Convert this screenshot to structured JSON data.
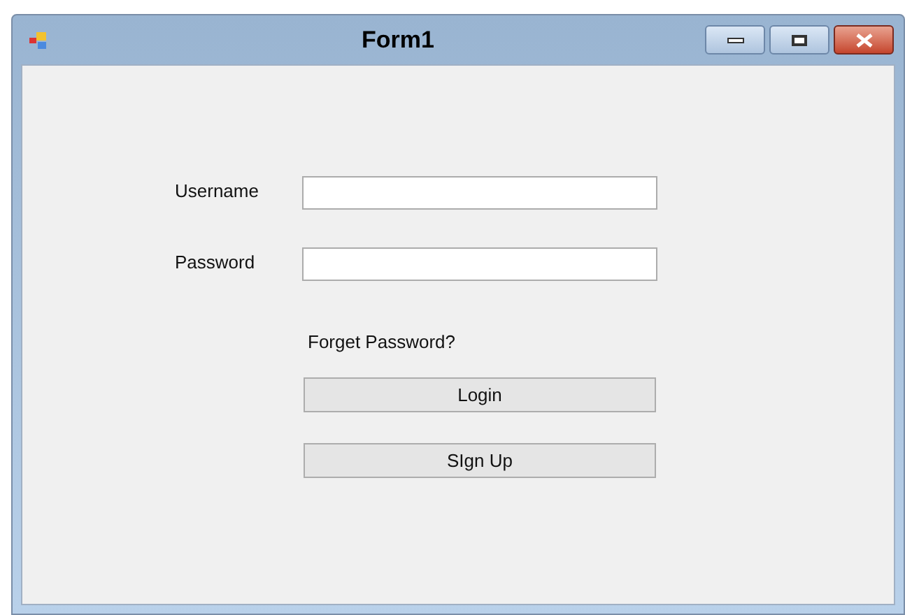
{
  "window": {
    "title": "Form1"
  },
  "fields": [
    {
      "label": "Username"
    },
    {
      "label": "Password"
    }
  ],
  "link": "Forget Password?",
  "buttons": [
    "Login",
    "SIgn Up"
  ]
}
